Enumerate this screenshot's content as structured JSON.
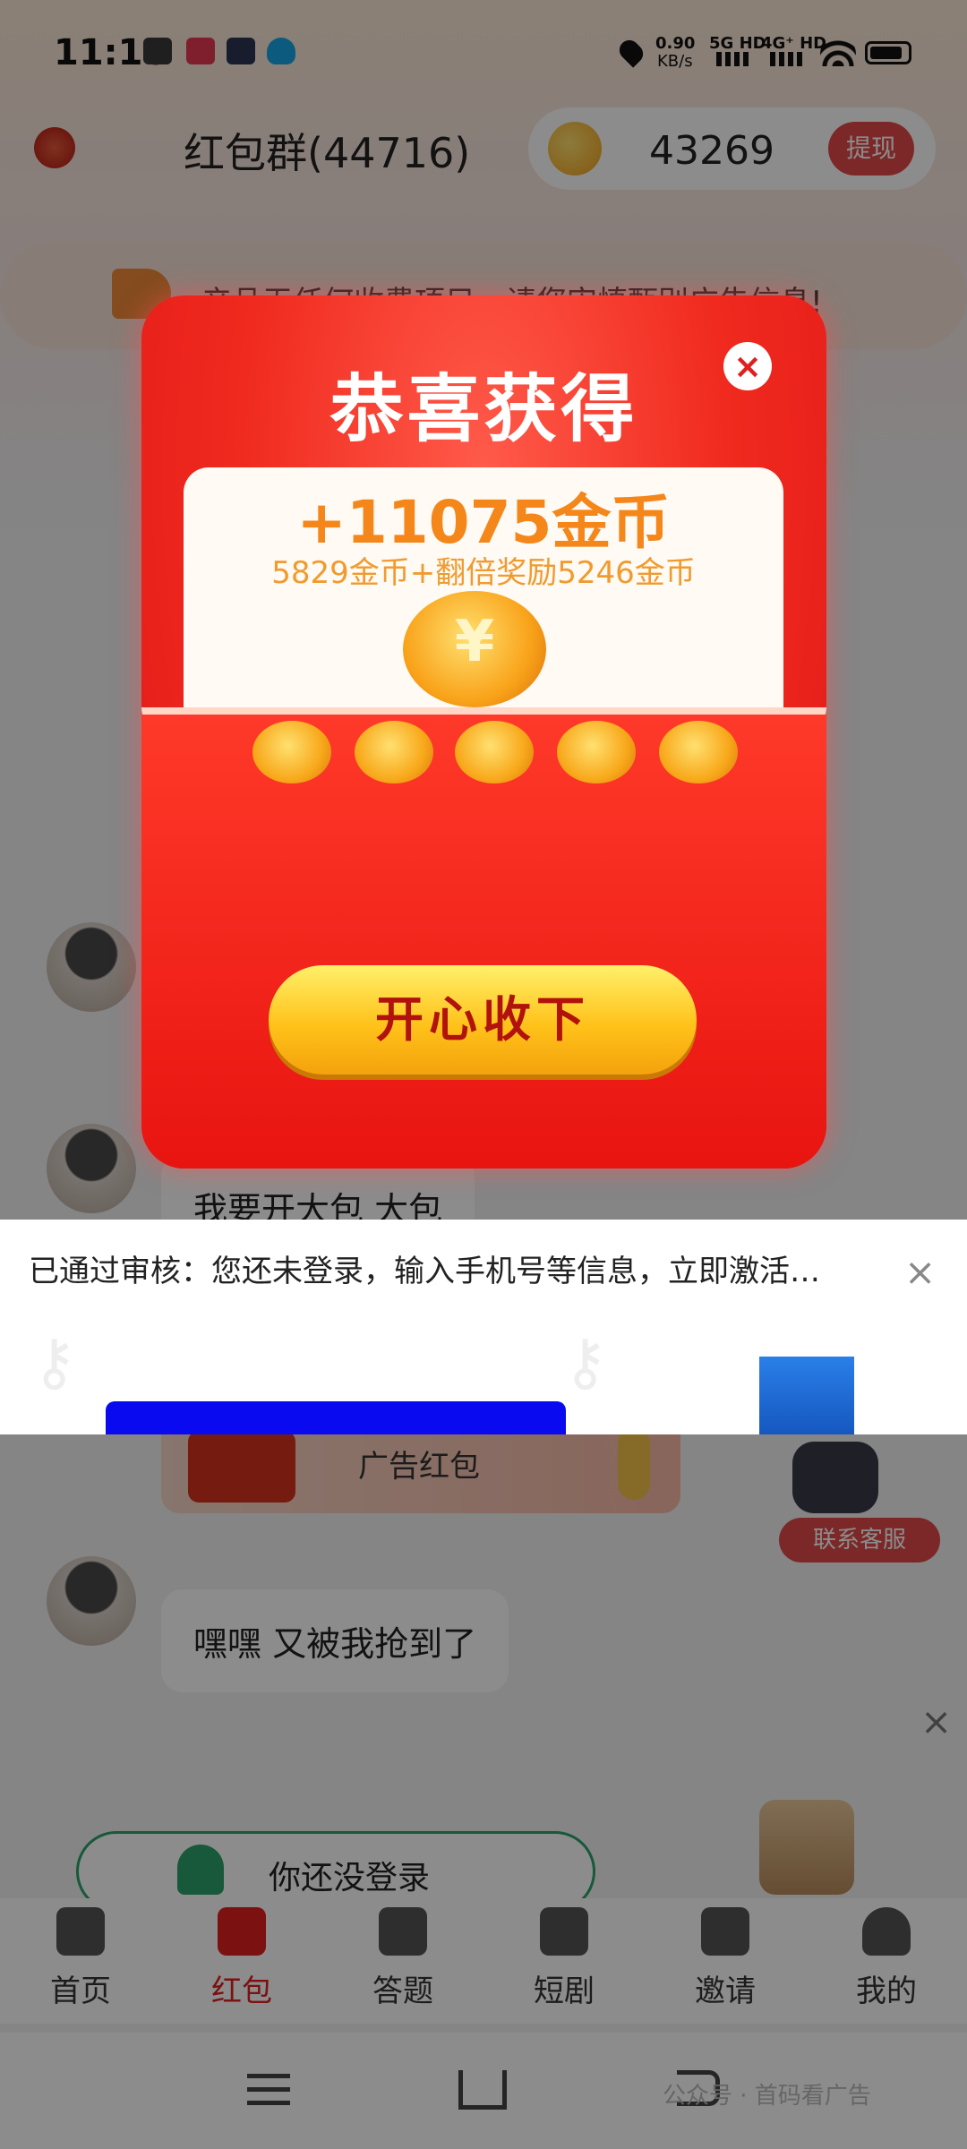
{
  "status_bar": {
    "time": "11:16",
    "net_speed": "0.90",
    "net_unit": "KB/s",
    "sig1": "5G HD",
    "sig2": "4G⁺ HD"
  },
  "header": {
    "title": "红包群(44716)",
    "coin_balance": "43269",
    "withdraw_label": "提现"
  },
  "notice": {
    "text": "产品无任何收费项目，请您审慎甄别广告信息!"
  },
  "chat": {
    "message_1": "我要开大包 大包",
    "redpack_label": "广告红包",
    "message_2": "嘿嘿  又被我抢到了",
    "customer_service": "联系客服",
    "login_prompt": "你还没登录"
  },
  "popup": {
    "title": "恭喜获得",
    "amount": "+11075金币",
    "breakdown": "5829金币+翻倍奖励5246金币",
    "accept_label": "开心收下",
    "close_glyph": "×"
  },
  "banner": {
    "text": "已通过审核：您还未登录，输入手机号等信息，立即激活…",
    "close_glyph": "×"
  },
  "tabs": [
    {
      "label": "首页",
      "icon": "home-icon"
    },
    {
      "label": "红包",
      "icon": "red-envelope-icon",
      "active": true
    },
    {
      "label": "答题",
      "icon": "quiz-icon"
    },
    {
      "label": "短剧",
      "icon": "clapperboard-icon"
    },
    {
      "label": "邀请",
      "icon": "invite-icon"
    },
    {
      "label": "我的",
      "icon": "profile-icon"
    }
  ],
  "colors": {
    "accent_red": "#e24a4a",
    "tab_active": "#e02020",
    "coin_gold": "#f4861a"
  },
  "watermark": "公众号 · 首码看广告"
}
